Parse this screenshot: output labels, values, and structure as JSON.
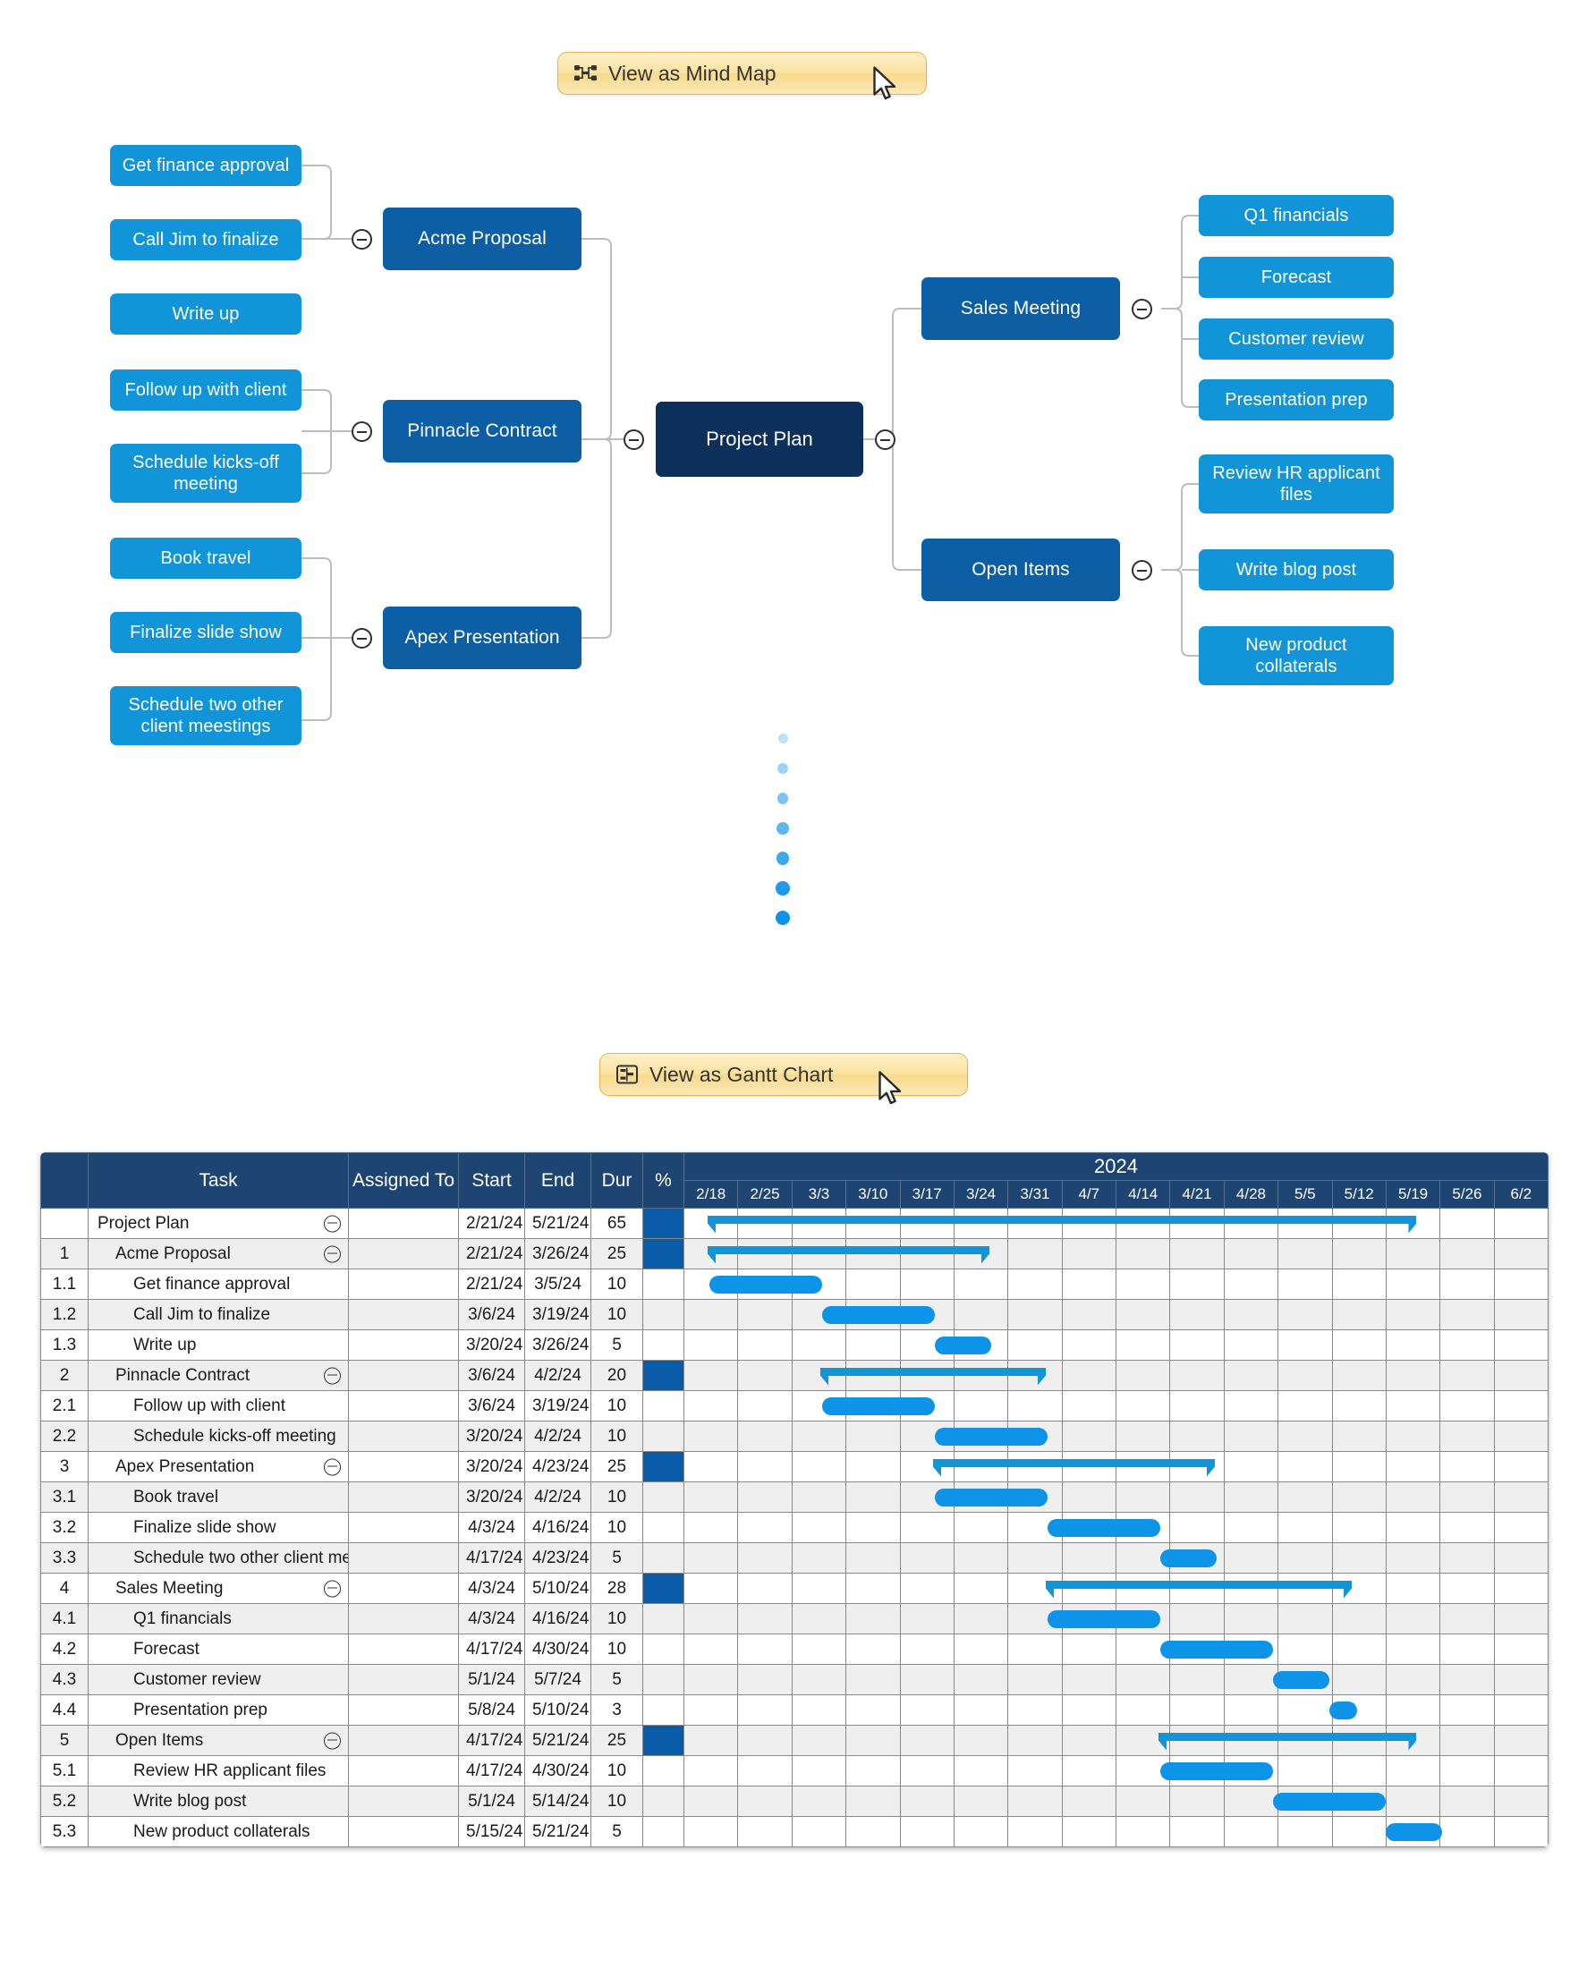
{
  "buttons": {
    "mindmap": {
      "label": "View as Mind Map",
      "icon": "mind-map-icon"
    },
    "gantt": {
      "label": "View as Gantt Chart",
      "icon": "gantt-chart-icon"
    }
  },
  "mindmap": {
    "root": "Project Plan",
    "left_branches": [
      {
        "label": "Acme Proposal",
        "children": [
          "Get finance approval",
          "Call Jim to finalize",
          "Write up"
        ]
      },
      {
        "label": "Pinnacle Contract",
        "children": [
          "Follow up with client",
          "Schedule kicks-off meeting"
        ]
      },
      {
        "label": "Apex Presentation",
        "children": [
          "Book travel",
          "Finalize slide show",
          "Schedule two other client meestings"
        ]
      }
    ],
    "right_branches": [
      {
        "label": "Sales Meeting",
        "children": [
          "Q1 financials",
          "Forecast",
          "Customer review",
          "Presentation prep"
        ]
      },
      {
        "label": "Open Items",
        "children": [
          "Review HR applicant files",
          "Write blog post",
          "New product collaterals"
        ]
      }
    ],
    "colors": {
      "root": "#0d2f5c",
      "branch": "#0b5ca4",
      "leaf": "#1294d8",
      "connector": "#b8b8b8"
    }
  },
  "loading_dots": {
    "count": 7,
    "color": "#0d93e8"
  },
  "gantt": {
    "headers": {
      "wbs": "",
      "task": "Task",
      "assigned": "Assigned To",
      "start": "Start",
      "end": "End",
      "dur": "Dur",
      "pct": "%",
      "year": "2024"
    },
    "weeks": [
      "2/18",
      "2/25",
      "3/3",
      "3/10",
      "3/17",
      "3/24",
      "3/31",
      "4/7",
      "4/14",
      "4/21",
      "4/28",
      "5/5",
      "5/12",
      "5/19",
      "5/26",
      "6/2"
    ],
    "rows": [
      {
        "wbs": "",
        "task": "Project Plan",
        "indent": 0,
        "assigned": "",
        "start": "2/21/24",
        "end": "5/21/24",
        "dur": "65",
        "pct_filled": true,
        "collapse": true,
        "summary": true,
        "bar_start": 0.42,
        "bar_end": 13.0
      },
      {
        "wbs": "1",
        "task": "Acme Proposal",
        "indent": 1,
        "assigned": "",
        "start": "2/21/24",
        "end": "3/26/24",
        "dur": "25",
        "pct_filled": true,
        "collapse": true,
        "summary": true,
        "bar_start": 0.42,
        "bar_end": 5.42
      },
      {
        "wbs": "1.1",
        "task": "Get finance approval",
        "indent": 2,
        "assigned": "",
        "start": "2/21/24",
        "end": "3/5/24",
        "dur": "10",
        "pct_filled": false,
        "collapse": false,
        "summary": false,
        "bar_start": 0.45,
        "bar_end": 2.45
      },
      {
        "wbs": "1.2",
        "task": "Call Jim to finalize",
        "indent": 2,
        "assigned": "",
        "start": "3/6/24",
        "end": "3/19/24",
        "dur": "10",
        "pct_filled": false,
        "collapse": false,
        "summary": false,
        "bar_start": 2.45,
        "bar_end": 4.45
      },
      {
        "wbs": "1.3",
        "task": "Write up",
        "indent": 2,
        "assigned": "",
        "start": "3/20/24",
        "end": "3/26/24",
        "dur": "5",
        "pct_filled": false,
        "collapse": false,
        "summary": false,
        "bar_start": 4.45,
        "bar_end": 5.45
      },
      {
        "wbs": "2",
        "task": "Pinnacle Contract",
        "indent": 1,
        "assigned": "",
        "start": "3/6/24",
        "end": "4/2/24",
        "dur": "20",
        "pct_filled": true,
        "collapse": true,
        "summary": true,
        "bar_start": 2.42,
        "bar_end": 6.42
      },
      {
        "wbs": "2.1",
        "task": "Follow up with client",
        "indent": 2,
        "assigned": "",
        "start": "3/6/24",
        "end": "3/19/24",
        "dur": "10",
        "pct_filled": false,
        "collapse": false,
        "summary": false,
        "bar_start": 2.45,
        "bar_end": 4.45
      },
      {
        "wbs": "2.2",
        "task": "Schedule kicks-off meeting",
        "indent": 2,
        "assigned": "",
        "start": "3/20/24",
        "end": "4/2/24",
        "dur": "10",
        "pct_filled": false,
        "collapse": false,
        "summary": false,
        "bar_start": 4.45,
        "bar_end": 6.45
      },
      {
        "wbs": "3",
        "task": "Apex Presentation",
        "indent": 1,
        "assigned": "",
        "start": "3/20/24",
        "end": "4/23/24",
        "dur": "25",
        "pct_filled": true,
        "collapse": true,
        "summary": true,
        "bar_start": 4.42,
        "bar_end": 9.42
      },
      {
        "wbs": "3.1",
        "task": "Book travel",
        "indent": 2,
        "assigned": "",
        "start": "3/20/24",
        "end": "4/2/24",
        "dur": "10",
        "pct_filled": false,
        "collapse": false,
        "summary": false,
        "bar_start": 4.45,
        "bar_end": 6.45
      },
      {
        "wbs": "3.2",
        "task": "Finalize slide show",
        "indent": 2,
        "assigned": "",
        "start": "4/3/24",
        "end": "4/16/24",
        "dur": "10",
        "pct_filled": false,
        "collapse": false,
        "summary": false,
        "bar_start": 6.45,
        "bar_end": 8.45
      },
      {
        "wbs": "3.3",
        "task": "Schedule two other client meestings",
        "indent": 2,
        "assigned": "",
        "start": "4/17/24",
        "end": "4/23/24",
        "dur": "5",
        "pct_filled": false,
        "collapse": false,
        "summary": false,
        "bar_start": 8.45,
        "bar_end": 9.45
      },
      {
        "wbs": "4",
        "task": "Sales Meeting",
        "indent": 1,
        "assigned": "",
        "start": "4/3/24",
        "end": "5/10/24",
        "dur": "28",
        "pct_filled": true,
        "collapse": true,
        "summary": true,
        "bar_start": 6.42,
        "bar_end": 11.85
      },
      {
        "wbs": "4.1",
        "task": "Q1 financials",
        "indent": 2,
        "assigned": "",
        "start": "4/3/24",
        "end": "4/16/24",
        "dur": "10",
        "pct_filled": false,
        "collapse": false,
        "summary": false,
        "bar_start": 6.45,
        "bar_end": 8.45
      },
      {
        "wbs": "4.2",
        "task": "Forecast",
        "indent": 2,
        "assigned": "",
        "start": "4/17/24",
        "end": "4/30/24",
        "dur": "10",
        "pct_filled": false,
        "collapse": false,
        "summary": false,
        "bar_start": 8.45,
        "bar_end": 10.45
      },
      {
        "wbs": "4.3",
        "task": "Customer review",
        "indent": 2,
        "assigned": "",
        "start": "5/1/24",
        "end": "5/7/24",
        "dur": "5",
        "pct_filled": false,
        "collapse": false,
        "summary": false,
        "bar_start": 10.45,
        "bar_end": 11.45
      },
      {
        "wbs": "4.4",
        "task": "Presentation prep",
        "indent": 2,
        "assigned": "",
        "start": "5/8/24",
        "end": "5/10/24",
        "dur": "3",
        "pct_filled": false,
        "collapse": false,
        "summary": false,
        "bar_start": 11.45,
        "bar_end": 11.95
      },
      {
        "wbs": "5",
        "task": "Open Items",
        "indent": 1,
        "assigned": "",
        "start": "4/17/24",
        "end": "5/21/24",
        "dur": "25",
        "pct_filled": true,
        "collapse": true,
        "summary": true,
        "bar_start": 8.42,
        "bar_end": 13.0
      },
      {
        "wbs": "5.1",
        "task": "Review HR applicant files",
        "indent": 2,
        "assigned": "",
        "start": "4/17/24",
        "end": "4/30/24",
        "dur": "10",
        "pct_filled": false,
        "collapse": false,
        "summary": false,
        "bar_start": 8.45,
        "bar_end": 10.45
      },
      {
        "wbs": "5.2",
        "task": "Write blog post",
        "indent": 2,
        "assigned": "",
        "start": "5/1/24",
        "end": "5/14/24",
        "dur": "10",
        "pct_filled": false,
        "collapse": false,
        "summary": false,
        "bar_start": 10.45,
        "bar_end": 12.45
      },
      {
        "wbs": "5.3",
        "task": "New product collaterals",
        "indent": 2,
        "assigned": "",
        "start": "5/15/24",
        "end": "5/21/24",
        "dur": "5",
        "pct_filled": false,
        "collapse": false,
        "summary": false,
        "bar_start": 12.45,
        "bar_end": 13.45
      }
    ],
    "colors": {
      "header": "#1e4571",
      "bar": "#0d93e8",
      "summary_bar": "#1294d8",
      "pct_fill": "#0a5ba8"
    }
  }
}
